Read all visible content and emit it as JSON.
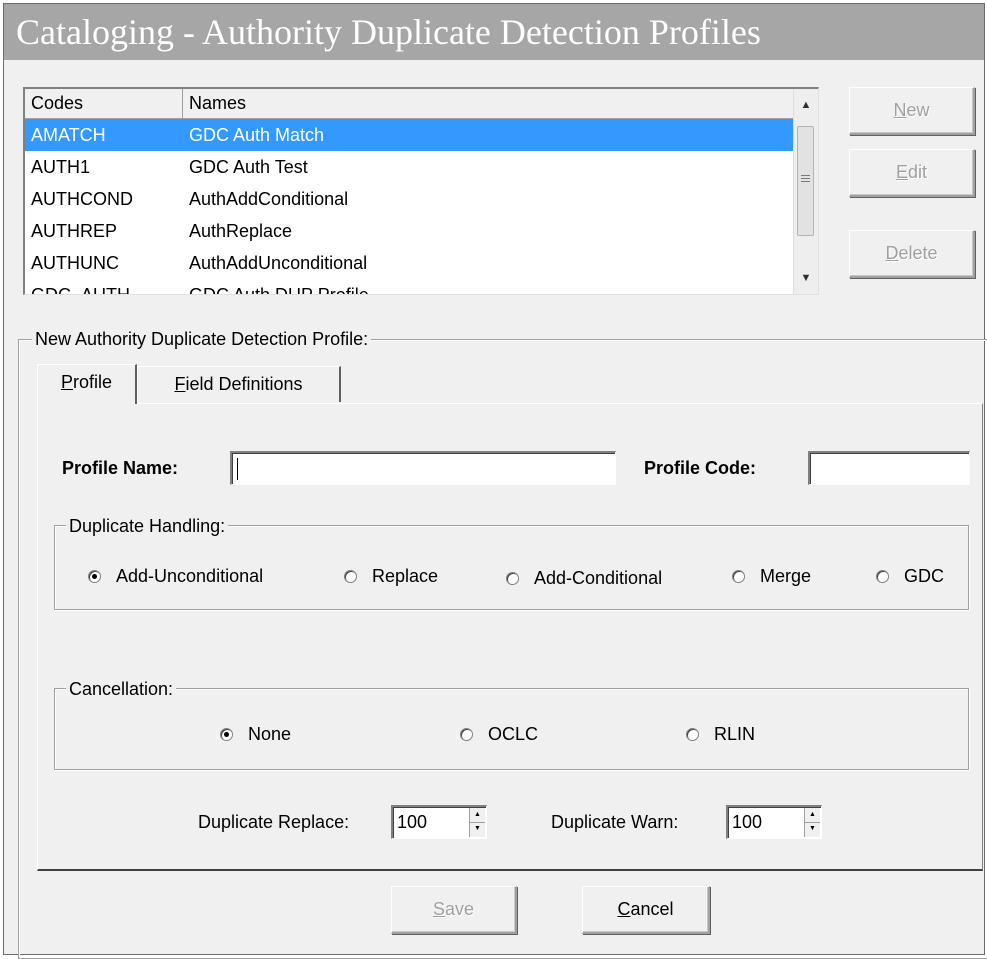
{
  "title": "Cataloging - Authority Duplicate Detection Profiles",
  "list": {
    "headers": {
      "codes": "Codes",
      "names": "Names"
    },
    "rows": [
      {
        "code": "AMATCH",
        "name": "GDC Auth Match",
        "selected": true
      },
      {
        "code": "AUTH1",
        "name": "GDC Auth Test"
      },
      {
        "code": "AUTHCOND",
        "name": "AuthAddConditional"
      },
      {
        "code": "AUTHREP",
        "name": "AuthReplace"
      },
      {
        "code": "AUTHUNC",
        "name": "AuthAddUnconditional"
      },
      {
        "code": "GDC_AUTH",
        "name": "GDC Auth DUP Profile"
      }
    ]
  },
  "buttons": {
    "new_label": "New",
    "new_mnemonic": "N",
    "new_rest": "ew",
    "edit_label": "Edit",
    "edit_mnemonic": "E",
    "edit_rest": "dit",
    "delete_label": "Delete",
    "delete_mnemonic": "D",
    "delete_rest": "elete",
    "save_mnemonic": "S",
    "save_rest": "ave",
    "cancel_mnemonic": "C",
    "cancel_rest": "ancel"
  },
  "group_title": "New Authority Duplicate Detection Profile:",
  "tabs": [
    {
      "mnemonic": "P",
      "rest": "rofile",
      "active": true
    },
    {
      "mnemonic": "F",
      "rest": "ield Definitions",
      "active": false
    }
  ],
  "profile": {
    "name_label": "Profile Name:",
    "name_value": "",
    "code_label": "Profile Code:",
    "code_value": ""
  },
  "duplicate_handling": {
    "title": "Duplicate Handling:",
    "options": [
      "Add-Unconditional",
      "Replace",
      "Add-Conditional",
      "Merge",
      "GDC"
    ],
    "selected": "Add-Unconditional"
  },
  "cancellation": {
    "title": "Cancellation:",
    "options": [
      "None",
      "OCLC",
      "RLIN"
    ],
    "selected": "None"
  },
  "duplicate_replace": {
    "label": "Duplicate Replace:",
    "value": "100"
  },
  "duplicate_warn": {
    "label": "Duplicate Warn:",
    "value": "100"
  },
  "colors": {
    "selection": "#3399ff",
    "window": "#f0f0f0",
    "title_bar": "#a6a6a6"
  }
}
